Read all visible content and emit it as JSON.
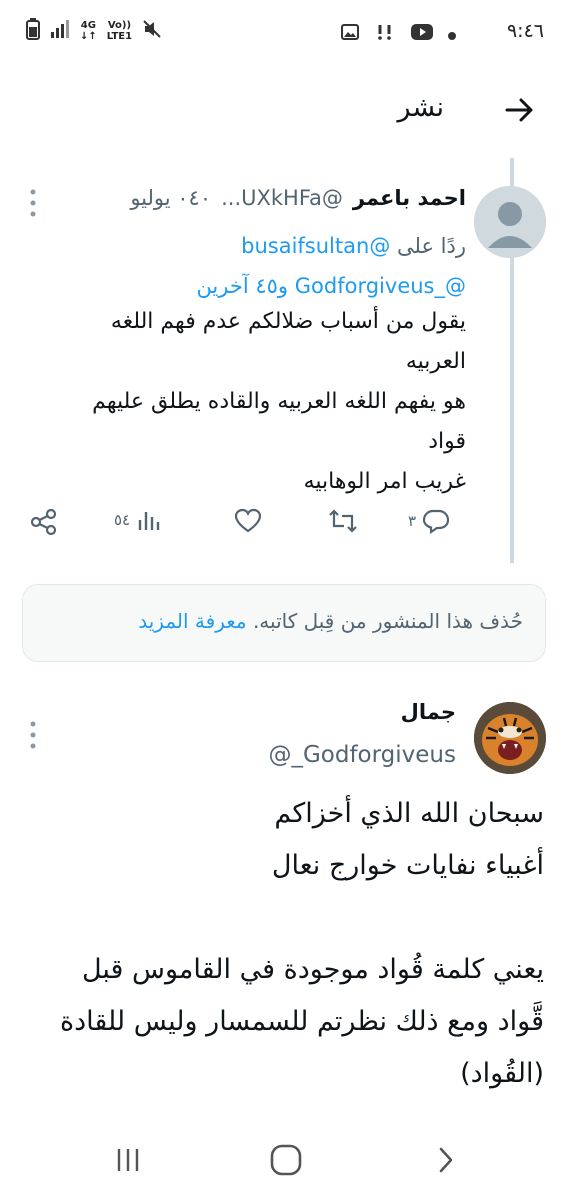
{
  "status_bar": {
    "time": "٩:٤٦",
    "network_type": "4G",
    "network_label": "LTE1",
    "volte_label": "Vo))",
    "icons_right": [
      "image-icon",
      "alert-icon",
      "youtube-icon",
      "dot-icon"
    ],
    "icons_left": [
      "mute-icon",
      "signal-icon",
      "battery-icon"
    ]
  },
  "header": {
    "title": "نشر",
    "back_icon": "arrow-right-icon"
  },
  "tweet1": {
    "name": "احمد باعمر",
    "handle": "@UXkHFa...",
    "date": "٠٤٠ يوليو",
    "reply_prefix": "ردًا على",
    "reply_to_1": "@busaifsultan",
    "reply_to_2": "@_Godforgiveus",
    "reply_others": "و٤٥ آخرين",
    "body": "يقول من أسباب ضلالكم عدم فهم اللغه\nالعربيه\nهو يفهم اللغه العربيه والقاده يطلق عليهم\nقواد\nغريب امر الوهابيه",
    "actions": {
      "replies": "٣",
      "reposts": "",
      "likes": "",
      "views": "٥٤"
    }
  },
  "deleted_notice": {
    "text": "حُذف هذا المنشور من قِبل كاتبه.",
    "link": "معرفة المزيد"
  },
  "tweet2": {
    "name": "جمال",
    "handle": "@_Godforgiveus",
    "body": "سبحان الله الذي أخزاكم\nأغبياء نفايات خوارج نعال\n\nيعني كلمة قُواد موجودة في القاموس قبل\nقَّواد ومع ذلك نظرتم للسمسار وليس للقادة\n(القُواد)"
  },
  "nav_bar": {
    "recents": "recents-icon",
    "home": "home-icon",
    "back": "back-chevron-icon"
  },
  "colors": {
    "accent": "#1d9bf0",
    "secondary_text": "#536471",
    "border": "#cfd9de"
  }
}
